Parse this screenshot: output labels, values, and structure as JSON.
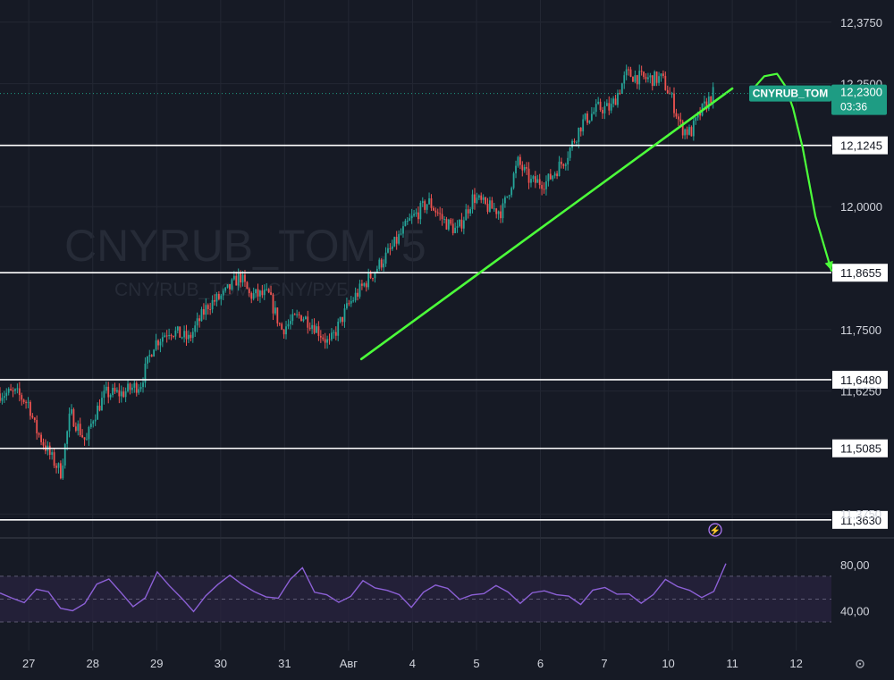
{
  "chart_data": [
    {
      "type": "candlestick",
      "symbol_label": "CNYRUB_TOM",
      "watermark": {
        "main": "CNYRUB_TOM, 5",
        "sub": "CNY/RUB_TOM · CNY/РУБ"
      },
      "price_ticks": [
        "12,3750",
        "12,2500",
        "12,0000",
        "11,7500",
        "11,6250",
        "11,3750"
      ],
      "price_tick_values": [
        12.375,
        12.25,
        12.0,
        11.75,
        11.625,
        11.375
      ],
      "ylim": [
        11.33,
        12.42
      ],
      "x_ticks": [
        "27",
        "28",
        "29",
        "30",
        "31",
        "Авг",
        "4",
        "5",
        "6",
        "7",
        "10",
        "11",
        "12"
      ],
      "xlim": [
        26.55,
        12.55
      ],
      "x_day_positions": [
        27,
        28,
        29,
        30,
        31,
        32,
        33,
        34,
        35,
        36,
        37,
        38,
        39
      ],
      "last_price": {
        "label": "CNYRUB_TOM",
        "value": "12,2300",
        "countdown": "03:36",
        "y": 12.23
      },
      "levels": [
        {
          "label": "12,1245",
          "y": 12.1245
        },
        {
          "label": "11,8655",
          "y": 11.8655
        },
        {
          "label": "11,6480",
          "y": 11.648
        },
        {
          "label": "11,5085",
          "y": 11.5085
        },
        {
          "label": "11,3630",
          "y": 11.363
        }
      ],
      "trendline": {
        "from": {
          "x": 32.2,
          "y": 11.69
        },
        "to": {
          "x": 38.0,
          "y": 12.24
        }
      },
      "forecast_path": [
        {
          "x": 38.33,
          "y": 12.24
        },
        {
          "x": 38.5,
          "y": 12.265
        },
        {
          "x": 38.7,
          "y": 12.27
        },
        {
          "x": 38.83,
          "y": 12.245
        },
        {
          "x": 38.95,
          "y": 12.2
        },
        {
          "x": 39.1,
          "y": 12.12
        },
        {
          "x": 39.3,
          "y": 11.98
        },
        {
          "x": 39.55,
          "y": 11.87
        }
      ],
      "price_path": [
        {
          "x": 26.55,
          "y": 11.62
        },
        {
          "x": 26.8,
          "y": 11.62
        },
        {
          "x": 27.0,
          "y": 11.6
        },
        {
          "x": 27.1,
          "y": 11.55
        },
        {
          "x": 27.35,
          "y": 11.49
        },
        {
          "x": 27.5,
          "y": 11.46
        },
        {
          "x": 27.65,
          "y": 11.58
        },
        {
          "x": 27.9,
          "y": 11.52
        },
        {
          "x": 28.0,
          "y": 11.57
        },
        {
          "x": 28.2,
          "y": 11.62
        },
        {
          "x": 28.45,
          "y": 11.62
        },
        {
          "x": 28.75,
          "y": 11.64
        },
        {
          "x": 28.95,
          "y": 11.72
        },
        {
          "x": 29.2,
          "y": 11.75
        },
        {
          "x": 29.5,
          "y": 11.73
        },
        {
          "x": 29.8,
          "y": 11.8
        },
        {
          "x": 30.05,
          "y": 11.82
        },
        {
          "x": 30.3,
          "y": 11.86
        },
        {
          "x": 30.45,
          "y": 11.82
        },
        {
          "x": 30.75,
          "y": 11.82
        },
        {
          "x": 30.95,
          "y": 11.75
        },
        {
          "x": 31.25,
          "y": 11.78
        },
        {
          "x": 31.45,
          "y": 11.76
        },
        {
          "x": 31.7,
          "y": 11.72
        },
        {
          "x": 32.0,
          "y": 11.8
        },
        {
          "x": 32.35,
          "y": 11.86
        },
        {
          "x": 32.65,
          "y": 11.91
        },
        {
          "x": 32.95,
          "y": 11.97
        },
        {
          "x": 33.25,
          "y": 12.01
        },
        {
          "x": 33.5,
          "y": 11.97
        },
        {
          "x": 33.7,
          "y": 11.95
        },
        {
          "x": 33.95,
          "y": 12.02
        },
        {
          "x": 34.15,
          "y": 12.0
        },
        {
          "x": 34.4,
          "y": 11.99
        },
        {
          "x": 34.65,
          "y": 12.09
        },
        {
          "x": 34.85,
          "y": 12.05
        },
        {
          "x": 35.1,
          "y": 12.05
        },
        {
          "x": 35.4,
          "y": 12.1
        },
        {
          "x": 35.65,
          "y": 12.17
        },
        {
          "x": 35.9,
          "y": 12.2
        },
        {
          "x": 36.1,
          "y": 12.2
        },
        {
          "x": 36.35,
          "y": 12.27
        },
        {
          "x": 36.6,
          "y": 12.26
        },
        {
          "x": 36.9,
          "y": 12.26
        },
        {
          "x": 37.05,
          "y": 12.22
        },
        {
          "x": 37.2,
          "y": 12.16
        },
        {
          "x": 37.35,
          "y": 12.15
        },
        {
          "x": 37.5,
          "y": 12.19
        },
        {
          "x": 37.7,
          "y": 12.23
        }
      ],
      "rsi": {
        "ticks": [
          "80,00",
          "40,00"
        ],
        "tick_values": [
          80,
          40
        ],
        "upper_band": 70,
        "lower_band": 30,
        "ylim": [
          5,
          102
        ],
        "values": [
          52,
          48,
          45,
          60,
          55,
          40,
          38,
          46,
          62,
          66,
          55,
          46,
          48,
          72,
          64,
          52,
          42,
          50,
          65,
          72,
          60,
          55,
          50,
          54,
          66,
          75,
          60,
          52,
          48,
          55,
          70,
          62,
          58,
          50,
          42,
          55,
          66,
          60,
          52,
          50,
          58,
          64,
          55,
          48,
          52,
          60,
          56,
          50,
          46,
          54,
          62,
          58,
          52,
          47,
          55,
          64,
          60,
          56,
          50,
          58,
          78
        ]
      },
      "bolt_badge": "⚡",
      "settings_icon": "gear-icon"
    }
  ],
  "colors": {
    "background": "#161a25",
    "grid": "#232733",
    "up": "#26a69a",
    "down": "#ef5350",
    "drawing": "#4cff3a",
    "level": "#ffffff",
    "rsi": "#8c60d6",
    "rsi_band": "#2a2440",
    "price_badge": "#1e9c83",
    "axis_text": "#d1d4dc"
  }
}
